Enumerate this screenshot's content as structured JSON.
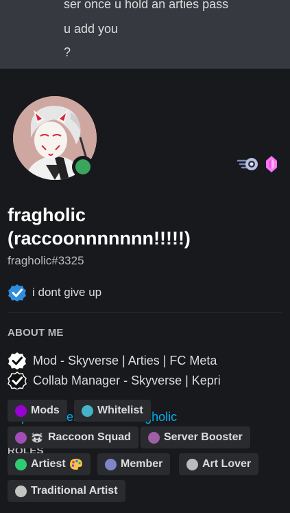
{
  "chat_preview": {
    "line1": "ser once u hold an arties pass",
    "line2": "u add you",
    "line3": "?"
  },
  "profile": {
    "display_name_line1": "fragholic",
    "display_name_line2": "(raccoonnnnnnn!!!!!)",
    "username": "fragholic#3325",
    "status_color": "#3ba55d",
    "badges": [
      "nitro-icon",
      "boost-gem-icon"
    ]
  },
  "custom_status": {
    "emoji": "verified-check-icon",
    "text": "i dont give up"
  },
  "about": {
    "title": "ABOUT ME",
    "lines": [
      "Mod - Skyverse | Arties | FC Meta",
      "Collab Manager - Skyverse | Kepri"
    ],
    "link": "https://twitter.com/natzfragholic"
  },
  "roles": {
    "title": "ROLES",
    "items": [
      {
        "label": "Mods",
        "color": "#9b00d3"
      },
      {
        "label": "Whitelist",
        "color": "#44b2c9"
      },
      {
        "label": "Raccoon Squad",
        "color": "#a34db8"
      },
      {
        "label": "Server Booster",
        "color": "#9e5fa7"
      },
      {
        "label": "Artiest",
        "color": "#2ecc71"
      },
      {
        "label": "Member",
        "color": "#7e86c7"
      },
      {
        "label": "Art Lover",
        "color": "#b9bbbe"
      },
      {
        "label": "Traditional Artist",
        "color": "#c4c4c4"
      }
    ]
  }
}
